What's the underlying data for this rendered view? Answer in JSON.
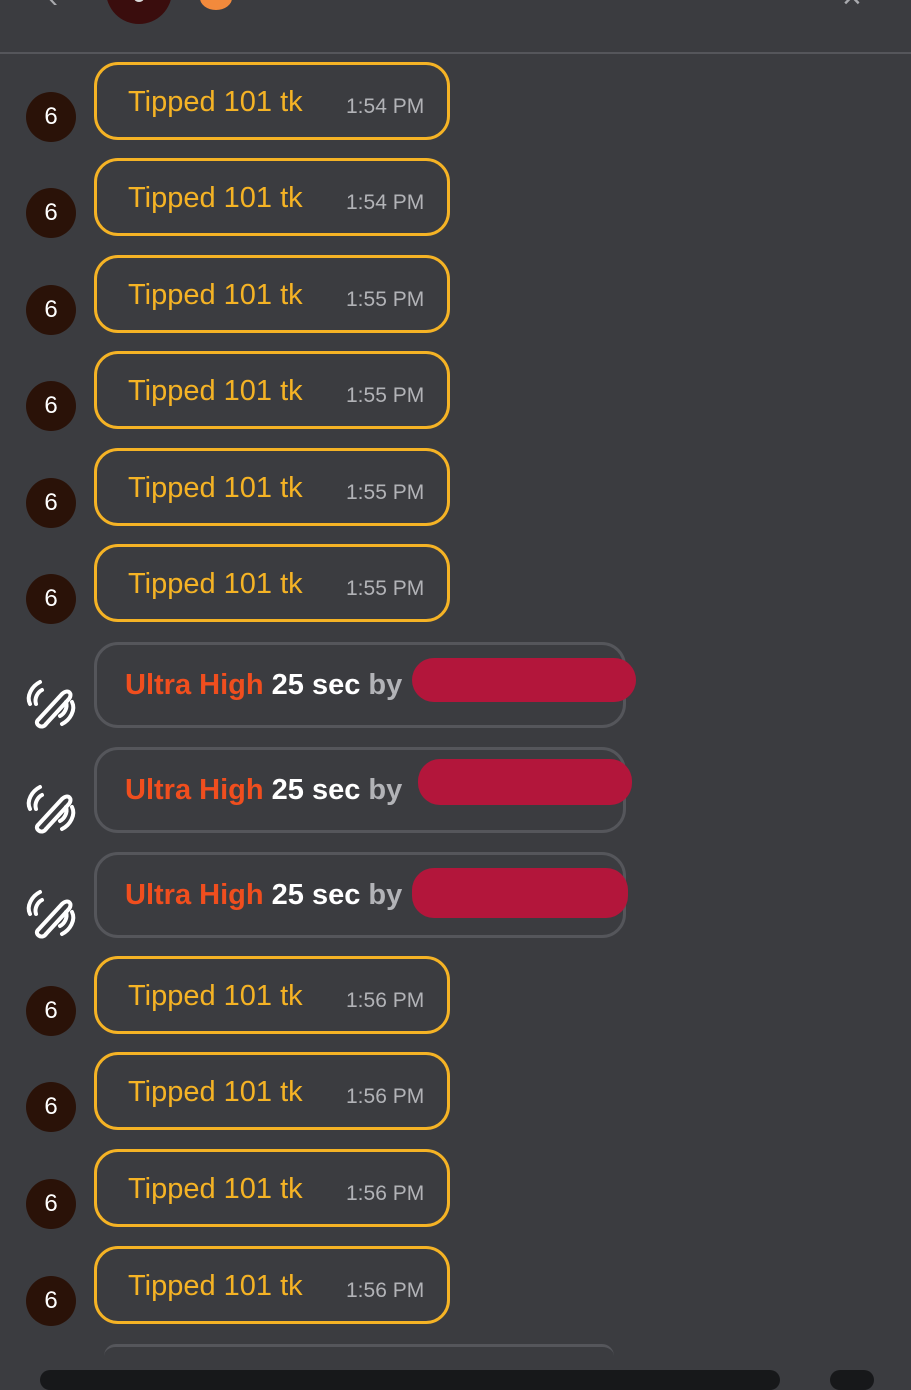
{
  "header": {
    "back_icon": "chevron-left-icon",
    "close_icon": "close-icon"
  },
  "colors": {
    "background": "#3b3c40",
    "tip_accent": "#f5b325",
    "vibe_level": "#f04e1e",
    "redaction": "#b3163b"
  },
  "messages": [
    {
      "type": "tip",
      "badge": "6",
      "text": "Tipped 101 tk",
      "time": "1:54 PM"
    },
    {
      "type": "tip",
      "badge": "6",
      "text": "Tipped 101 tk",
      "time": "1:54 PM"
    },
    {
      "type": "tip",
      "badge": "6",
      "text": "Tipped 101 tk",
      "time": "1:55 PM"
    },
    {
      "type": "tip",
      "badge": "6",
      "text": "Tipped 101 tk",
      "time": "1:55 PM"
    },
    {
      "type": "tip",
      "badge": "6",
      "text": "Tipped 101 tk",
      "time": "1:55 PM"
    },
    {
      "type": "tip",
      "badge": "6",
      "text": "Tipped 101 tk",
      "time": "1:55 PM"
    },
    {
      "type": "vibe",
      "icon": "vibration-icon",
      "level": "Ultra High",
      "duration": "25 sec",
      "by": "by"
    },
    {
      "type": "vibe",
      "icon": "vibration-icon",
      "level": "Ultra High",
      "duration": "25 sec",
      "by": "by"
    },
    {
      "type": "vibe",
      "icon": "vibration-icon",
      "level": "Ultra High",
      "duration": "25 sec",
      "by": "by"
    },
    {
      "type": "tip",
      "badge": "6",
      "text": "Tipped 101 tk",
      "time": "1:56 PM"
    },
    {
      "type": "tip",
      "badge": "6",
      "text": "Tipped 101 tk",
      "time": "1:56 PM"
    },
    {
      "type": "tip",
      "badge": "6",
      "text": "Tipped 101 tk",
      "time": "1:56 PM"
    },
    {
      "type": "tip",
      "badge": "6",
      "text": "Tipped 101 tk",
      "time": "1:56 PM"
    }
  ]
}
